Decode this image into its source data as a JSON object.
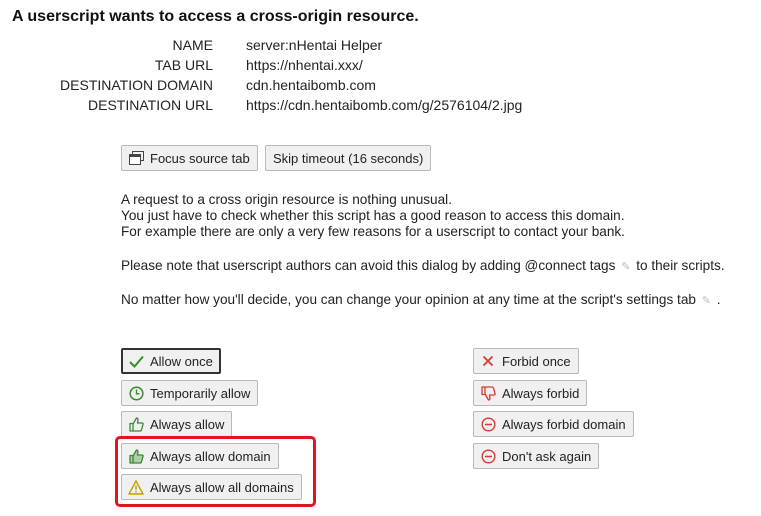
{
  "title": "A userscript wants to access a cross-origin resource.",
  "info": [
    {
      "key": "NAME",
      "value": "server:nHentai Helper"
    },
    {
      "key": "TAB URL",
      "value": "https://nhentai.xxx/"
    },
    {
      "key": "DESTINATION DOMAIN",
      "value": "cdn.hentaibomb.com"
    },
    {
      "key": "DESTINATION URL",
      "value": "https://cdn.hentaibomb.com/g/2576104/2.jpg"
    }
  ],
  "actions": {
    "focus_tab": "Focus source tab",
    "skip_timeout": "Skip timeout (16 seconds)"
  },
  "message": {
    "line1": "A request to a cross origin resource is nothing unusual.",
    "line2": "You just have to check whether this script has a good reason to access this domain.",
    "line3": "For example there are only a very few reasons for a userscript to contact your bank.",
    "line4_before": "Please note that userscript authors can avoid this dialog by adding @connect tags",
    "line4_after": "to their scripts.",
    "line5_before": "No matter how you'll decide, you can change your opinion at any time at the script's settings tab",
    "line5_after": "."
  },
  "allow": {
    "once": "Allow once",
    "temporarily": "Temporarily allow",
    "always": "Always allow",
    "domain": "Always allow domain",
    "all_domains": "Always allow all domains"
  },
  "forbid": {
    "once": "Forbid once",
    "always": "Always forbid",
    "domain": "Always forbid domain",
    "dont_ask": "Don't ask again"
  },
  "colors": {
    "allow_green": "#3a8a2e",
    "forbid_red": "#d63b2f",
    "warning_yellow": "#c8a000",
    "highlight_red": "#e0161c"
  }
}
